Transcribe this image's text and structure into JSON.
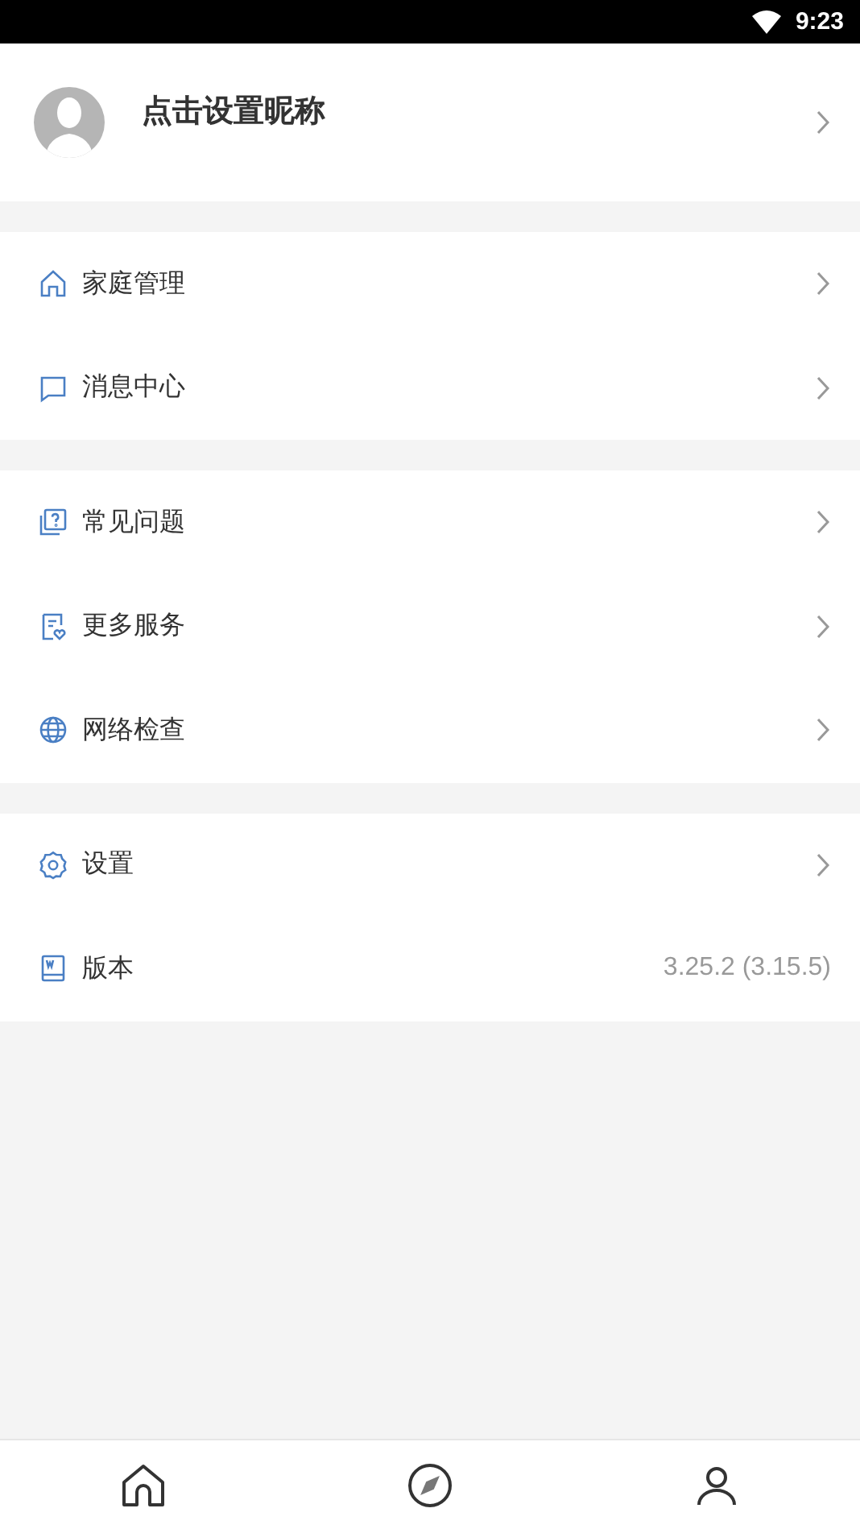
{
  "status_bar": {
    "time": "9:23"
  },
  "profile": {
    "nickname": "点击设置昵称"
  },
  "groups": [
    {
      "items": [
        {
          "label": "家庭管理"
        },
        {
          "label": "消息中心"
        }
      ]
    },
    {
      "items": [
        {
          "label": "常见问题"
        },
        {
          "label": "更多服务"
        },
        {
          "label": "网络检查"
        }
      ]
    },
    {
      "items": [
        {
          "label": "设置"
        },
        {
          "label": "版本",
          "value": "3.25.2 (3.15.5)"
        }
      ]
    }
  ]
}
